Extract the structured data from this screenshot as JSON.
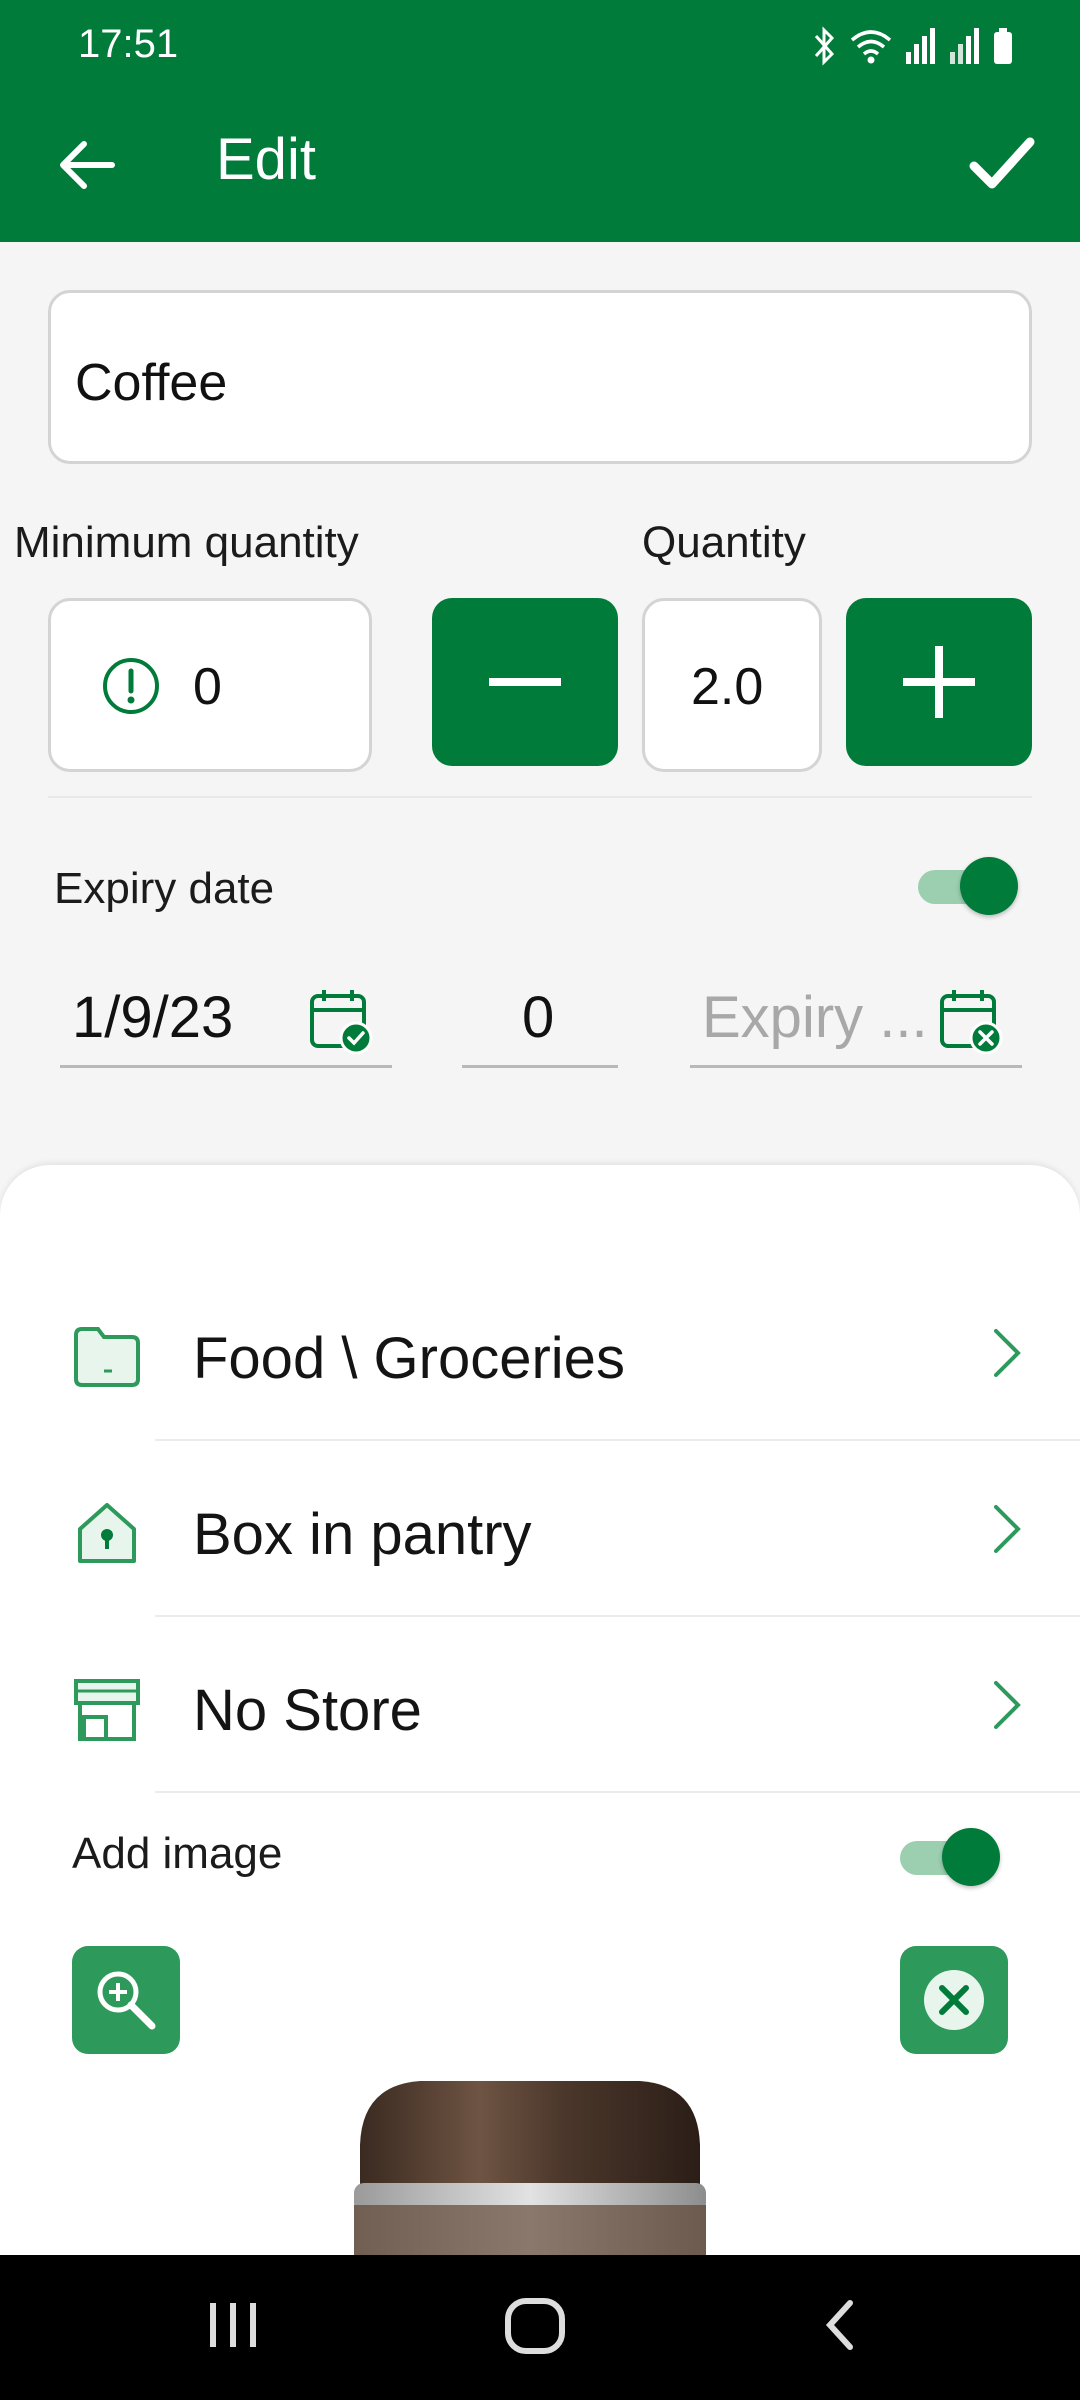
{
  "status_bar": {
    "time": "17:51",
    "icons": [
      "bluetooth-icon",
      "wifi-icon",
      "signal-icon",
      "signal-icon",
      "battery-icon"
    ]
  },
  "app_bar": {
    "title": "Edit",
    "back_icon": "arrow-left-icon",
    "confirm_icon": "check-icon"
  },
  "form": {
    "name_value": "Coffee",
    "min_quantity_label": "Minimum quantity",
    "min_quantity_value": "0",
    "quantity_label": "Quantity",
    "quantity_value": "2.0",
    "expiry_label": "Expiry date",
    "expiry_enabled": true,
    "purchase_date": "1/9/23",
    "days_value": "0",
    "expiry_placeholder": "Expiry ..."
  },
  "details": {
    "rows": [
      {
        "label": "Food \\ Groceries",
        "icon": "folder-icon"
      },
      {
        "label": "Box in pantry",
        "icon": "location-icon"
      },
      {
        "label": "No Store",
        "icon": "store-icon"
      }
    ]
  },
  "image_section": {
    "label": "Add image",
    "enabled": true
  },
  "colors": {
    "primary": "#007b3a",
    "primary_light": "#2d9a5b",
    "accent_chevron": "#2d9a5b"
  }
}
